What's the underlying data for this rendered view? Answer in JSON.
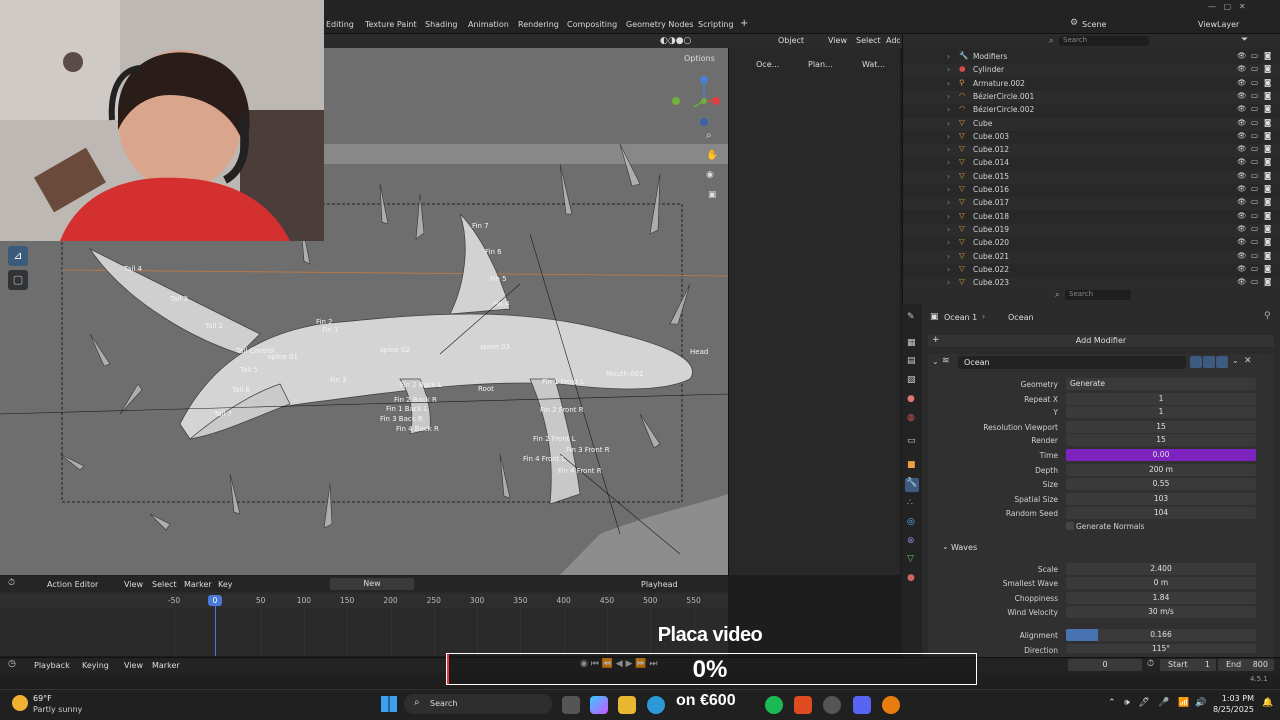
{
  "workspace_tabs": [
    "Editing",
    "Texture Paint",
    "Shading",
    "Animation",
    "Rendering",
    "Compositing",
    "Geometry Nodes",
    "Scripting"
  ],
  "scene": "Scene",
  "view_layer": "ViewLayer",
  "viewport": {
    "mode": "Object",
    "menus": [
      "View",
      "Select",
      "Add"
    ],
    "options_label": "Options",
    "bones": [
      "Fin 7",
      "Fin 6",
      "Fin 5",
      "Fin 4",
      "Tail 4",
      "Tail 3",
      "Tail 2",
      "Fin 2",
      "Fin 1",
      "Tail Control",
      "Tail 5",
      "Tail 6",
      "Tail 7",
      "Fin 3",
      "Root",
      "Mouth 001",
      "Fin 2 Back L",
      "Fin 2 Back R",
      "Fin 1 Back L",
      "Fin 3 Back R",
      "Fin 4 Back R",
      "Fin 1 Front L",
      "Fin 2 Front R",
      "Fin 2 Front L",
      "Fin 3 Front R",
      "Fin 4 Front L",
      "Fin 4 Front R",
      "Head",
      "spine 01",
      "spine 02",
      "spine 03"
    ]
  },
  "breadcrumb": [
    "Oce...",
    "Plan...",
    "Wat..."
  ],
  "outliner": {
    "search_placeholder": "Search",
    "items": [
      {
        "name": "Modifiers",
        "type": "modifier"
      },
      {
        "name": "Cylinder",
        "type": "material"
      },
      {
        "name": "Armature.002",
        "type": "armature"
      },
      {
        "name": "BézierCircle.001",
        "type": "curve"
      },
      {
        "name": "BézierCircle.002",
        "type": "curve"
      },
      {
        "name": "Cube",
        "type": "mesh"
      },
      {
        "name": "Cube.003",
        "type": "mesh"
      },
      {
        "name": "Cube.012",
        "type": "mesh"
      },
      {
        "name": "Cube.014",
        "type": "mesh"
      },
      {
        "name": "Cube.015",
        "type": "mesh"
      },
      {
        "name": "Cube.016",
        "type": "mesh"
      },
      {
        "name": "Cube.017",
        "type": "mesh"
      },
      {
        "name": "Cube.018",
        "type": "mesh"
      },
      {
        "name": "Cube.019",
        "type": "mesh"
      },
      {
        "name": "Cube.020",
        "type": "mesh"
      },
      {
        "name": "Cube.021",
        "type": "mesh"
      },
      {
        "name": "Cube.022",
        "type": "mesh"
      },
      {
        "name": "Cube.023",
        "type": "mesh"
      }
    ]
  },
  "properties": {
    "search_placeholder": "Search",
    "object_name": "Ocean 1",
    "modifier_crumb": "Ocean",
    "add_modifier": "Add Modifier",
    "modifier_name": "Ocean",
    "fields": [
      {
        "label": "Geometry",
        "value": "Generate"
      },
      {
        "label": "Repeat X",
        "value": "1"
      },
      {
        "label": "Y",
        "value": "1"
      },
      {
        "label": "Resolution Viewport",
        "value": "15"
      },
      {
        "label": "Render",
        "value": "15"
      },
      {
        "label": "Time",
        "value": "0.00"
      },
      {
        "label": "Depth",
        "value": "200 m"
      },
      {
        "label": "Size",
        "value": "0.55"
      },
      {
        "label": "Spatial Size",
        "value": "103"
      },
      {
        "label": "Random Seed",
        "value": "104"
      }
    ],
    "generate_normals": "Generate Normals",
    "waves_label": "Waves",
    "wave_fields": [
      {
        "label": "Scale",
        "value": "2.400"
      },
      {
        "label": "Smallest Wave",
        "value": "0 m"
      },
      {
        "label": "Choppiness",
        "value": "1.84"
      },
      {
        "label": "Wind Velocity",
        "value": "30 m/s"
      }
    ],
    "alignment_label": "Alignment",
    "alignment_value": "0.166",
    "alignment_fraction": 0.166,
    "direction_label": "Direction",
    "direction_value": "115°",
    "accent_color": "#7d24c0"
  },
  "action_editor": {
    "editor_label": "Action Editor",
    "menus": [
      "View",
      "Select",
      "Marker",
      "Key"
    ],
    "new_label": "New",
    "playhead_label": "Playhead",
    "ruler": [
      "-50",
      "0",
      "50",
      "100",
      "150",
      "200",
      "250",
      "300",
      "350",
      "400",
      "450",
      "500",
      "550"
    ],
    "current_frame": "0"
  },
  "timeline": {
    "menus": [
      "Playback",
      "Keying",
      "View",
      "Marker"
    ],
    "frame": "0",
    "start_label": "Start",
    "start": "1",
    "end_label": "End",
    "end": "800"
  },
  "status": {
    "version": "4.5.1"
  },
  "overlay": {
    "title": "Placa video",
    "percent": "0%"
  },
  "taskbar": {
    "weather_temp": "69°F",
    "weather_desc": "Partly sunny",
    "search": "Search",
    "promo": "on €600",
    "time": "1:03 PM",
    "date": "8/25/2025"
  }
}
